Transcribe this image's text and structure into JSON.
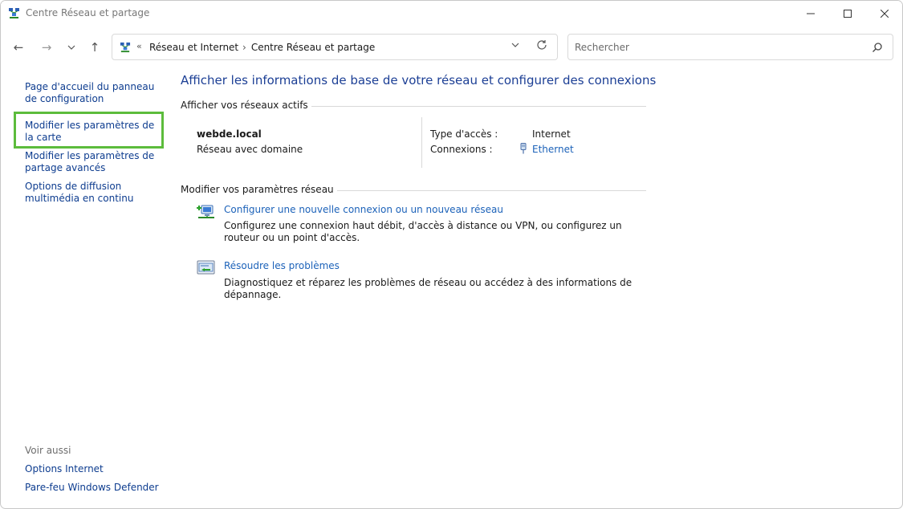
{
  "window": {
    "title": "Centre Réseau et partage"
  },
  "nav": {
    "breadcrumb": [
      "Réseau et Internet",
      "Centre Réseau et partage"
    ],
    "overflow_glyph": "«",
    "search_placeholder": "Rechercher"
  },
  "sidebar": {
    "links": [
      "Page d'accueil du panneau de configuration",
      "Modifier les paramètres de la carte",
      "Modifier les paramètres de partage avancés",
      "Options de diffusion multimédia en continu"
    ],
    "see_also_label": "Voir aussi",
    "see_also_links": [
      "Options Internet",
      "Pare-feu Windows Defender"
    ],
    "highlight_color": "#5cbc3c"
  },
  "main": {
    "heading": "Afficher les informations de base de votre réseau et configurer des connexions",
    "active_networks_label": "Afficher vos réseaux actifs",
    "network": {
      "name": "webde.local",
      "category": "Réseau avec domaine",
      "access_type_label": "Type d'accès :",
      "access_type_value": "Internet",
      "connections_label": "Connexions :",
      "connections_value": "Ethernet"
    },
    "change_settings_label": "Modifier vos paramètres réseau",
    "tasks": [
      {
        "icon": "new-connection-icon",
        "link": "Configurer une nouvelle connexion ou un nouveau réseau",
        "description": "Configurez une connexion haut débit, d'accès à distance ou VPN, ou configurez un routeur ou un point d'accès."
      },
      {
        "icon": "troubleshoot-icon",
        "link": "Résoudre les problèmes",
        "description": "Diagnostiquez et réparez les problèmes de réseau ou accédez à des informations de dépannage."
      }
    ]
  },
  "colors": {
    "heading": "#1c3f95",
    "link": "#1c62b9",
    "sidebar_link": "#0d3c8f"
  }
}
